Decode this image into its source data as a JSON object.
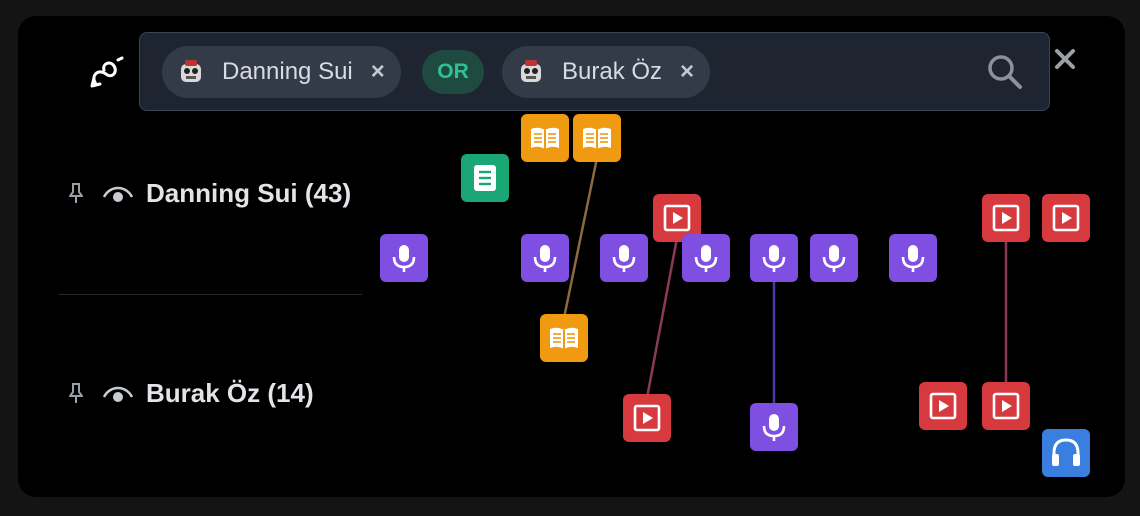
{
  "search": {
    "chips": [
      {
        "label": "Danning Sui",
        "remove": "×"
      },
      {
        "label": "Burak Öz",
        "remove": "×"
      }
    ],
    "operator": "OR"
  },
  "rows": [
    {
      "name": "Danning Sui (43)"
    },
    {
      "name": "Burak Öz (14)"
    }
  ],
  "colors": {
    "panel_bg": "#000000",
    "orange": "#ef9a10",
    "green": "#1aa775",
    "red": "#d63a3f",
    "purple": "#7e4fe0",
    "blue": "#3a7fe0"
  },
  "timeline": {
    "items": [
      {
        "type": "book",
        "color": "orange",
        "row": "Danning Sui"
      },
      {
        "type": "book",
        "color": "orange",
        "row": "Danning Sui"
      },
      {
        "type": "article",
        "color": "green",
        "row": "Danning Sui"
      },
      {
        "type": "video",
        "color": "red",
        "row": "Danning Sui"
      },
      {
        "type": "video",
        "color": "red",
        "row": "Danning Sui"
      },
      {
        "type": "video",
        "color": "red",
        "row": "Danning Sui"
      },
      {
        "type": "mic",
        "color": "purple",
        "row": "Danning Sui"
      },
      {
        "type": "mic",
        "color": "purple",
        "row": "Danning Sui"
      },
      {
        "type": "mic",
        "color": "purple",
        "row": "Danning Sui"
      },
      {
        "type": "mic",
        "color": "purple",
        "row": "Danning Sui"
      },
      {
        "type": "mic",
        "color": "purple",
        "row": "Danning Sui"
      },
      {
        "type": "mic",
        "color": "purple",
        "row": "Danning Sui"
      },
      {
        "type": "mic",
        "color": "purple",
        "row": "Danning Sui"
      },
      {
        "type": "book",
        "color": "orange",
        "row": "Burak Öz"
      },
      {
        "type": "video",
        "color": "red",
        "row": "Burak Öz"
      },
      {
        "type": "mic",
        "color": "purple",
        "row": "Burak Öz"
      },
      {
        "type": "video",
        "color": "red",
        "row": "Burak Öz"
      },
      {
        "type": "video",
        "color": "red",
        "row": "Burak Öz"
      },
      {
        "type": "headphones",
        "color": "blue",
        "row": "Burak Öz"
      }
    ]
  }
}
